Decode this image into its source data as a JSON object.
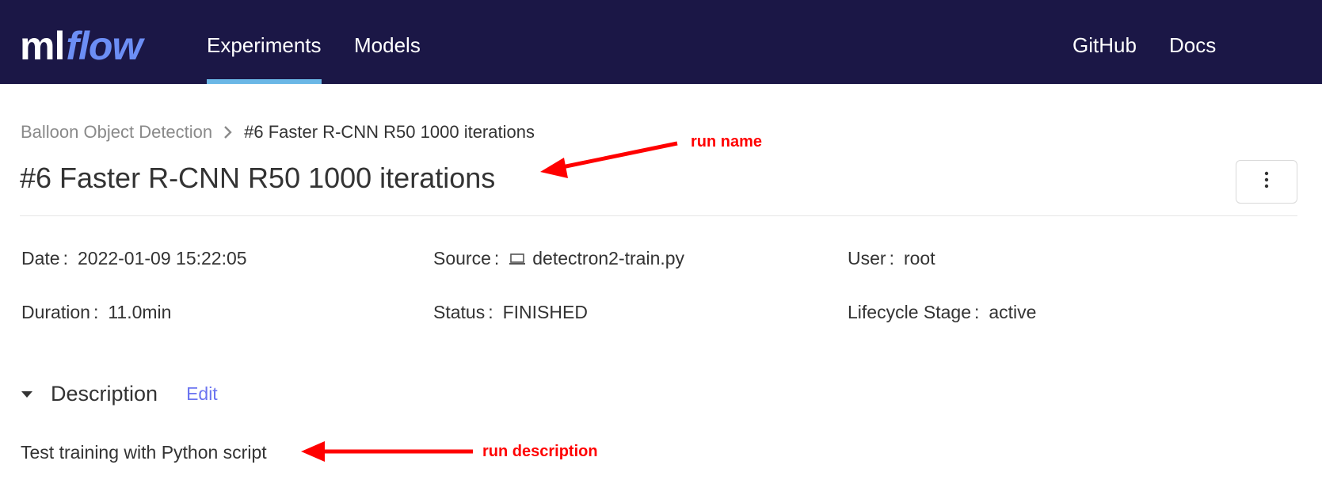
{
  "navbar": {
    "logo_ml": "ml",
    "logo_flow": "flow",
    "links": [
      {
        "label": "Experiments",
        "active": true
      },
      {
        "label": "Models",
        "active": false
      }
    ],
    "right_links": [
      {
        "label": "GitHub"
      },
      {
        "label": "Docs"
      }
    ],
    "background_color": "#1b1746",
    "active_underline_color": "#6bb7e6"
  },
  "breadcrumb": {
    "parent": "Balloon Object Detection",
    "separator_icon": "chevron-right-icon",
    "current": "#6 Faster R-CNN R50 1000 iterations"
  },
  "page": {
    "title": "#6 Faster R-CNN R50 1000 iterations",
    "menu_icon": "vertical-ellipsis-icon"
  },
  "metadata": {
    "date": {
      "label": "Date",
      "value": "2022-01-09 15:22:05"
    },
    "source": {
      "label": "Source",
      "value": "detectron2-train.py",
      "icon": "laptop-icon"
    },
    "user": {
      "label": "User",
      "value": "root"
    },
    "duration": {
      "label": "Duration",
      "value": "11.0min"
    },
    "status": {
      "label": "Status",
      "value": "FINISHED"
    },
    "lifecycle": {
      "label": "Lifecycle Stage",
      "value": "active"
    }
  },
  "description": {
    "title": "Description",
    "edit_label": "Edit",
    "text": "Test training with Python script",
    "toggle_icon": "caret-down-icon"
  },
  "annotations": {
    "run_name": "run name",
    "run_description": "run description",
    "color": "#ff0000"
  }
}
